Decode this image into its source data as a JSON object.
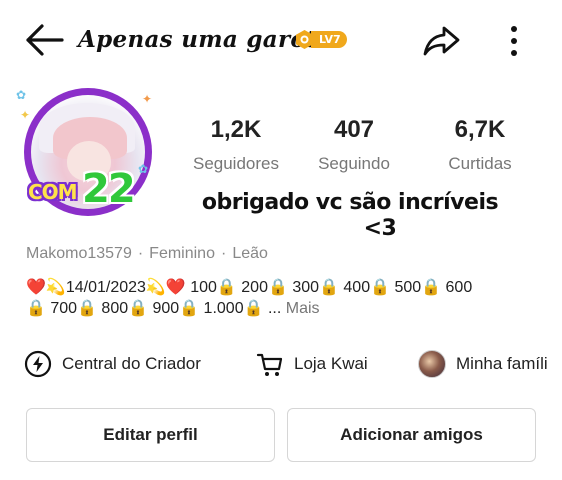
{
  "header": {
    "title": "Apenas uma garota",
    "level_badge": "LV7",
    "icons": [
      "back-arrow-icon",
      "share-icon",
      "more-vertical-icon"
    ]
  },
  "profile": {
    "avatar_badge_text": "COM",
    "avatar_badge_number": "22"
  },
  "stats": [
    {
      "value": "1,2K",
      "label": "Seguidores"
    },
    {
      "value": "407",
      "label": "Seguindo"
    },
    {
      "value": "6,7K",
      "label": "Curtidas"
    }
  ],
  "overlay_caption": {
    "line1": "obrigado vc são incríveis",
    "line2": "<3"
  },
  "info": {
    "username": "Makomo13579",
    "gender": "Feminino",
    "sign": "Leão",
    "separator": "·"
  },
  "bio": {
    "line1": "❤️💫14/01/2023💫❤️ 100🔒 200🔒 300🔒 400🔒 500🔒 600",
    "line2": "🔒 700🔒 800🔒 900🔒 1.000🔒 ...",
    "more_label": "Mais"
  },
  "shortcuts": [
    {
      "label": "Central do Criador",
      "icon": "lightning-icon"
    },
    {
      "label": "Loja Kwai",
      "icon": "cart-icon"
    },
    {
      "label": "Minha famíli",
      "icon": "family-avatar"
    }
  ],
  "actions": {
    "edit_profile": "Editar perfil",
    "add_friends": "Adicionar amigos"
  },
  "colors": {
    "level_badge": "#f0a81c",
    "avatar_ring": "#8b2fc9",
    "badge_number": "#30c83a",
    "badge_com": "#ffe24a"
  }
}
